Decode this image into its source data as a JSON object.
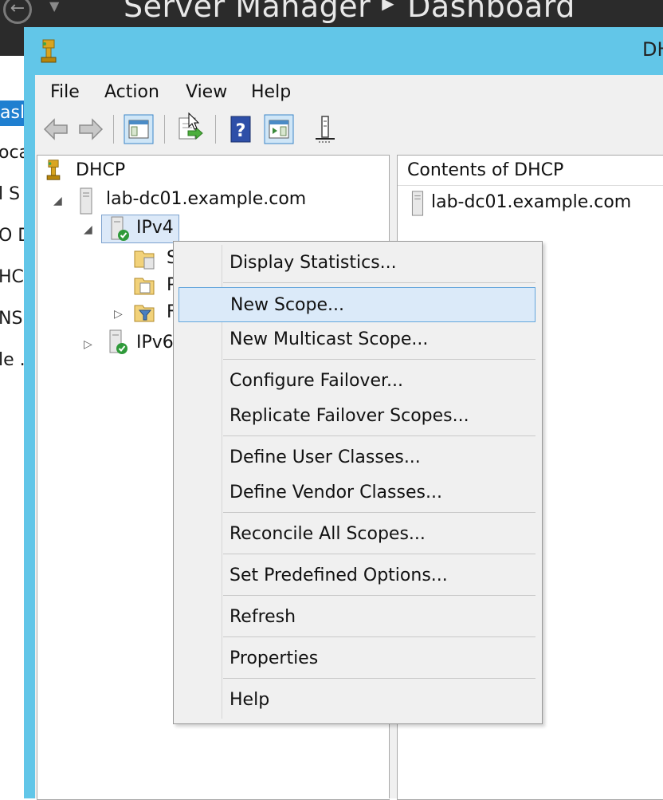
{
  "background_app": {
    "title": "Server Manager",
    "subtitle": "Dashboard",
    "left_items": [
      {
        "label": "asl",
        "selected": true
      },
      {
        "label": "oca",
        "selected": false
      },
      {
        "label": "l S",
        "selected": false
      },
      {
        "label": "O D",
        "selected": false
      },
      {
        "label": "HC",
        "selected": false
      },
      {
        "label": "NS",
        "selected": false
      },
      {
        "label": "le .",
        "selected": false
      }
    ]
  },
  "window": {
    "title": "DH",
    "frame_color": "#62c6e8"
  },
  "menubar": {
    "items": [
      "File",
      "Action",
      "View",
      "Help"
    ]
  },
  "toolbar": {
    "icons": [
      "back-arrow-icon",
      "forward-arrow-icon",
      "show-hide-console-tree-icon",
      "export-list-icon",
      "help-icon",
      "show-hide-action-pane-icon",
      "server-status-icon"
    ]
  },
  "tree": {
    "root": "DHCP",
    "server": "lab-dc01.example.com",
    "ipv4": "IPv4",
    "children": [
      "S",
      "P",
      "F"
    ],
    "ipv6": "IPv6"
  },
  "content": {
    "column_header": "Contents of DHCP",
    "items": [
      "lab-dc01.example.com"
    ]
  },
  "context_menu": {
    "items": [
      {
        "label": "Display Statistics...",
        "highlighted": false
      },
      {
        "label": "New Scope...",
        "highlighted": true
      },
      {
        "label": "New Multicast Scope...",
        "highlighted": false
      },
      {
        "label": "Configure Failover...",
        "highlighted": false
      },
      {
        "label": "Replicate Failover Scopes...",
        "highlighted": false
      },
      {
        "label": "Define User Classes...",
        "highlighted": false
      },
      {
        "label": "Define Vendor Classes...",
        "highlighted": false
      },
      {
        "label": "Reconcile All Scopes...",
        "highlighted": false
      },
      {
        "label": "Set Predefined Options...",
        "highlighted": false
      },
      {
        "label": "Refresh",
        "highlighted": false
      },
      {
        "label": "Properties",
        "highlighted": false
      },
      {
        "label": "Help",
        "highlighted": false
      }
    ]
  },
  "colors": {
    "accent_selection": "#1f7fd0",
    "menu_highlight": "#dbeaf9",
    "menu_highlight_border": "#63a6dc"
  }
}
